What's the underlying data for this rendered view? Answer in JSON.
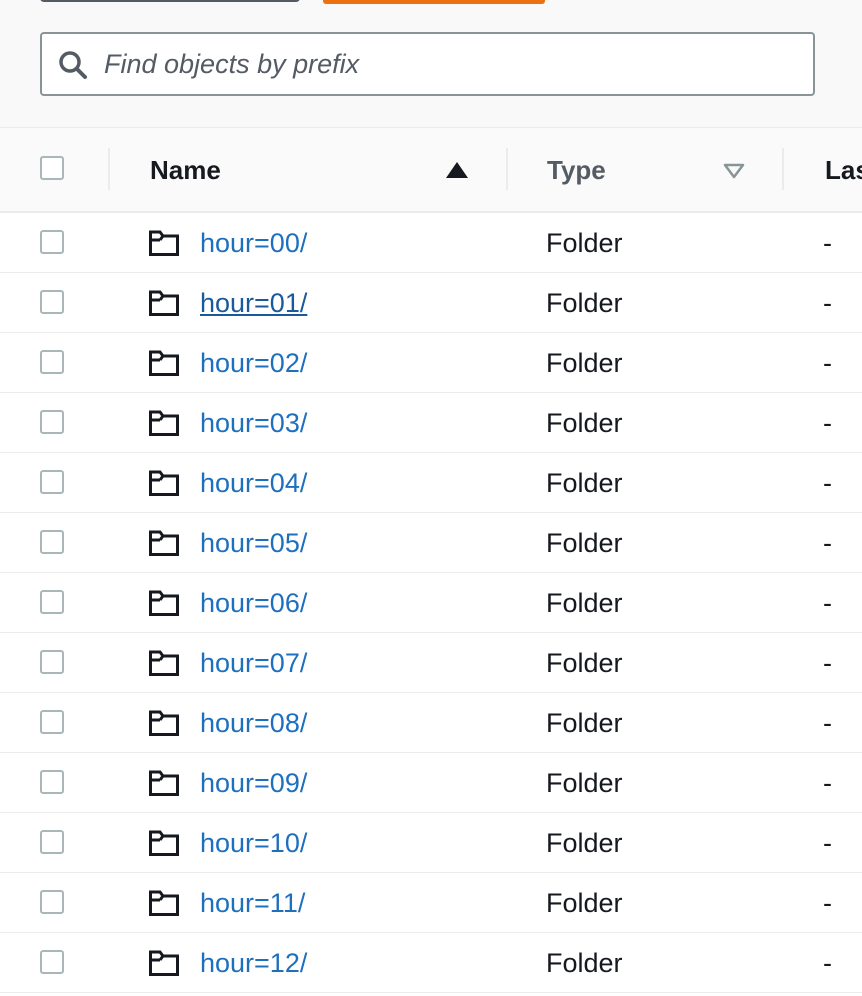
{
  "search": {
    "placeholder": "Find objects by prefix"
  },
  "table": {
    "columns": {
      "name": "Name",
      "type": "Type",
      "last": "Las"
    },
    "sort": {
      "column": "Name",
      "direction": "ascending"
    },
    "rows": [
      {
        "name": "hour=00/",
        "type": "Folder",
        "last": "-"
      },
      {
        "name": "hour=01/",
        "type": "Folder",
        "last": "-"
      },
      {
        "name": "hour=02/",
        "type": "Folder",
        "last": "-"
      },
      {
        "name": "hour=03/",
        "type": "Folder",
        "last": "-"
      },
      {
        "name": "hour=04/",
        "type": "Folder",
        "last": "-"
      },
      {
        "name": "hour=05/",
        "type": "Folder",
        "last": "-"
      },
      {
        "name": "hour=06/",
        "type": "Folder",
        "last": "-"
      },
      {
        "name": "hour=07/",
        "type": "Folder",
        "last": "-"
      },
      {
        "name": "hour=08/",
        "type": "Folder",
        "last": "-"
      },
      {
        "name": "hour=09/",
        "type": "Folder",
        "last": "-"
      },
      {
        "name": "hour=10/",
        "type": "Folder",
        "last": "-"
      },
      {
        "name": "hour=11/",
        "type": "Folder",
        "last": "-"
      },
      {
        "name": "hour=12/",
        "type": "Folder",
        "last": "-"
      }
    ]
  },
  "colors": {
    "link": "#1f6fbf",
    "primary_button": "#ec7211",
    "border": "#879596"
  },
  "icons": {
    "search": "search-icon",
    "folder": "folder-icon",
    "sort_asc": "sort-ascending-icon",
    "sort_desc": "sort-descending-icon"
  }
}
